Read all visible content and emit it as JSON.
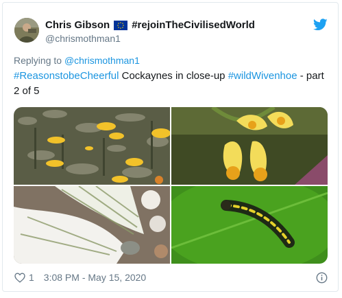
{
  "author": {
    "name": "Chris Gibson",
    "flag_icon": "eu-flag-icon",
    "name_suffix": "#rejoinTheCivilisedWorld",
    "handle": "@chrismothman1"
  },
  "reply": {
    "prefix": "Replying to",
    "mention": "@chrismothman1"
  },
  "tweet": {
    "hashtag1": "#ReasonstobeCheerful",
    "text1": " Cockaynes in close-up ",
    "hashtag2": "#wildWivenhoe",
    "text2": " - part 2 of 5"
  },
  "media": {
    "photos": [
      "yellow-flowers-meadow",
      "yellow-cowslip-flowers",
      "white-butterfly-on-blossom",
      "caterpillar-on-leaf"
    ]
  },
  "footer": {
    "likes": "1",
    "timestamp": "3:08 PM - May 15, 2020"
  },
  "colors": {
    "link": "#1b95e0",
    "secondary": "#657786",
    "twitter_blue": "#1da1f2"
  }
}
